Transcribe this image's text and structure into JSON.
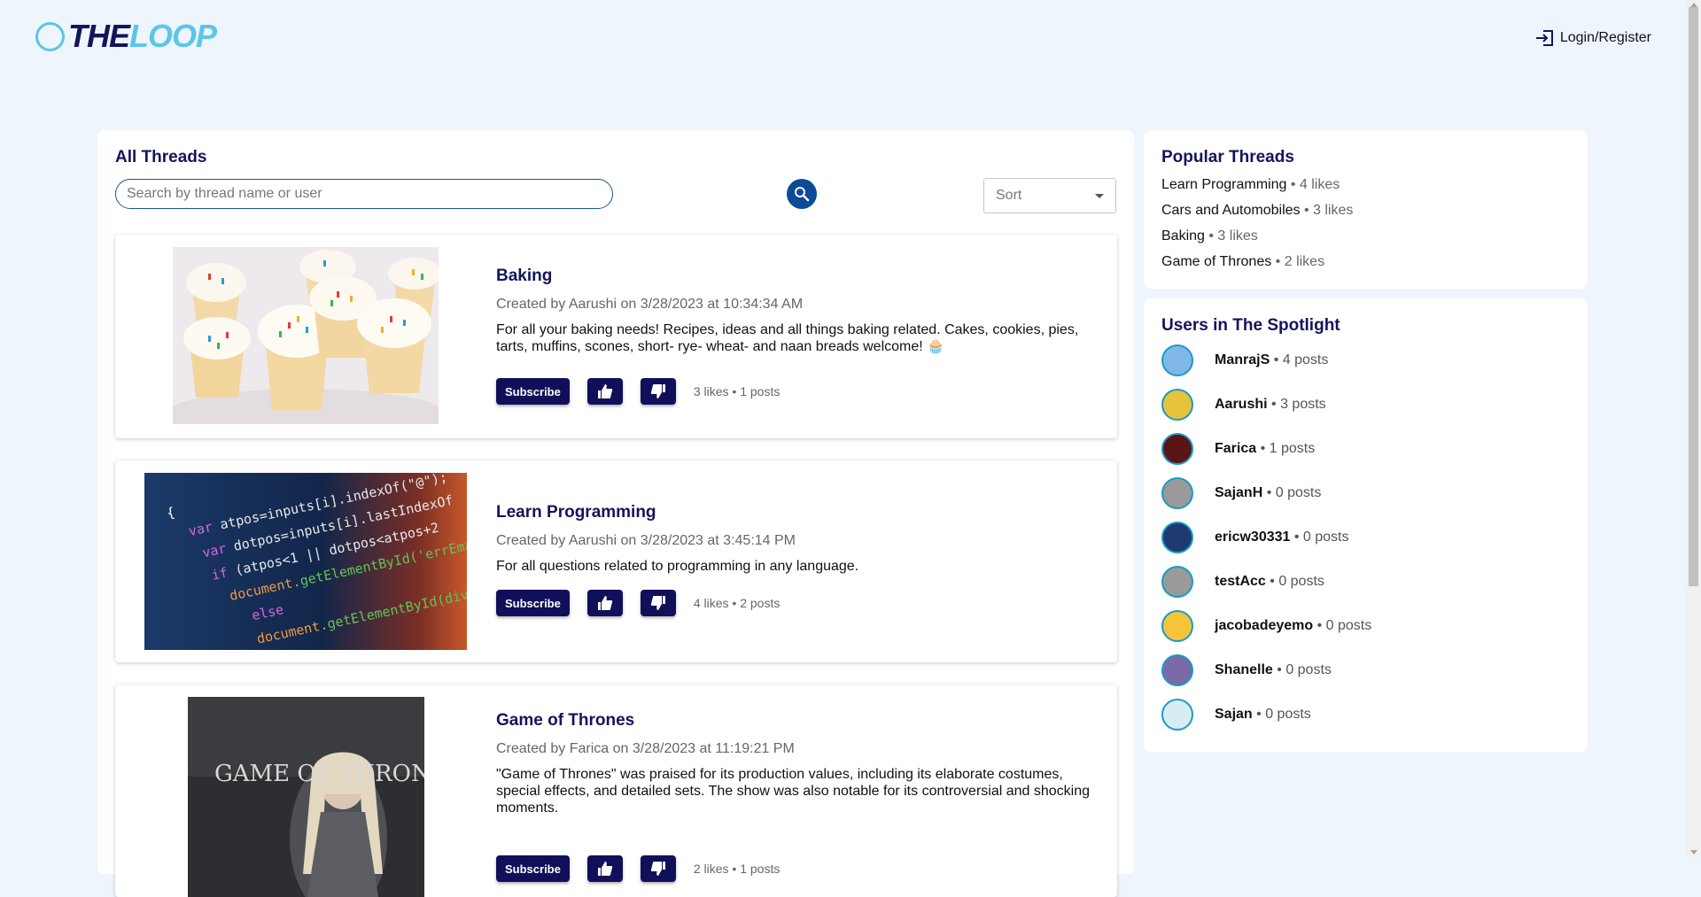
{
  "header": {
    "logo_the": "THE",
    "logo_loop": "LOOP",
    "login_label": "Login/Register"
  },
  "main": {
    "title": "All Threads",
    "search_placeholder": "Search by thread name or user",
    "sort_label": "Sort",
    "threads": [
      {
        "title": "Baking",
        "meta": "Created by Aarushi on 3/28/2023 at 10:34:34 AM",
        "description": "For all your baking needs! Recipes, ideas and all things baking related. Cakes, cookies, pies, tarts, muffins, scones, short- rye- wheat- and naan breads welcome! 🧁",
        "subscribe_label": "Subscribe",
        "stats": "3 likes • 1 posts",
        "image": "cupcakes-image"
      },
      {
        "title": "Learn Programming",
        "meta": "Created by Aarushi on 3/28/2023 at 3:45:14 PM",
        "description": "For all questions related to programming in any language.",
        "subscribe_label": "Subscribe",
        "stats": "4 likes • 2 posts",
        "image": "code-screen-image"
      },
      {
        "title": "Game of Thrones",
        "meta": "Created by Farica on 3/28/2023 at 11:19:21 PM",
        "description": "\"Game of Thrones\" was praised for its production values, including its elaborate costumes, special effects, and detailed sets. The show was also notable for its controversial and shocking moments.",
        "subscribe_label": "Subscribe",
        "stats": "2 likes • 1 posts",
        "image": "game-of-thrones-poster",
        "image_text": "GAME OF THRONES"
      }
    ]
  },
  "popular": {
    "title": "Popular Threads",
    "items": [
      {
        "name": "Learn Programming",
        "count": "• 4 likes"
      },
      {
        "name": "Cars and Automobiles",
        "count": "• 3 likes"
      },
      {
        "name": "Baking",
        "count": "• 3 likes"
      },
      {
        "name": "Game of Thrones",
        "count": "• 2 likes"
      }
    ]
  },
  "spotlight": {
    "title": "Users in The Spotlight",
    "users": [
      {
        "name": "ManrajS",
        "posts": "• 4 posts",
        "color": "#7fb8e6"
      },
      {
        "name": "Aarushi",
        "posts": "• 3 posts",
        "color": "#e8c23a"
      },
      {
        "name": "Farica",
        "posts": "• 1 posts",
        "color": "#5a1414"
      },
      {
        "name": "SajanH",
        "posts": "• 0 posts",
        "color": "#9a9a9a"
      },
      {
        "name": "ericw30331",
        "posts": "• 0 posts",
        "color": "#1e3a6e"
      },
      {
        "name": "testAcc",
        "posts": "• 0 posts",
        "color": "#9a9a9a"
      },
      {
        "name": "jacobadeyemo",
        "posts": "• 0 posts",
        "color": "#f5c43b"
      },
      {
        "name": "Shanelle",
        "posts": "• 0 posts",
        "color": "#7a6aa8"
      },
      {
        "name": "Sajan",
        "posts": "• 0 posts",
        "color": "#d8ecf4"
      }
    ]
  },
  "colors": {
    "brand_navy": "#14145c",
    "brand_cyan": "#5cc6e8",
    "button": "#120f5a",
    "background": "#eef5fd"
  }
}
